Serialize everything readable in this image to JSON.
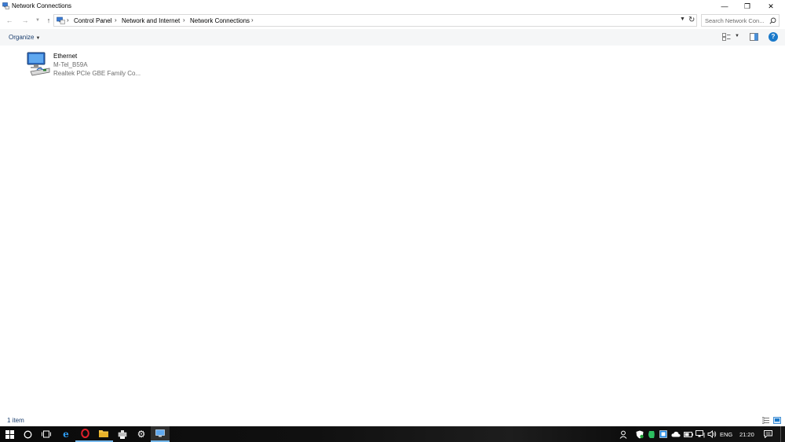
{
  "window": {
    "title": "Network Connections",
    "minimize_glyph": "—",
    "maximize_glyph": "❐",
    "close_glyph": "✕"
  },
  "nav": {
    "back_icon": "arrow-left-icon",
    "forward_icon": "arrow-right-icon",
    "up_icon": "arrow-up-icon"
  },
  "breadcrumb": {
    "items": [
      "Control Panel",
      "Network and Internet",
      "Network Connections"
    ]
  },
  "search": {
    "placeholder": "Search Network Con..."
  },
  "toolbar": {
    "organize_label": "Organize"
  },
  "connections": [
    {
      "name": "Ethernet",
      "status": "M-Tel_B59A",
      "device": "Realtek PCIe GBE Family Co..."
    }
  ],
  "statusbar": {
    "count": "1 item"
  },
  "taskbar": {
    "language": "ENG",
    "time": "21:20"
  },
  "colors": {
    "accent": "#1979ca",
    "link_text": "#1a3e6e",
    "taskbar_indicator": "#76b9ed"
  }
}
